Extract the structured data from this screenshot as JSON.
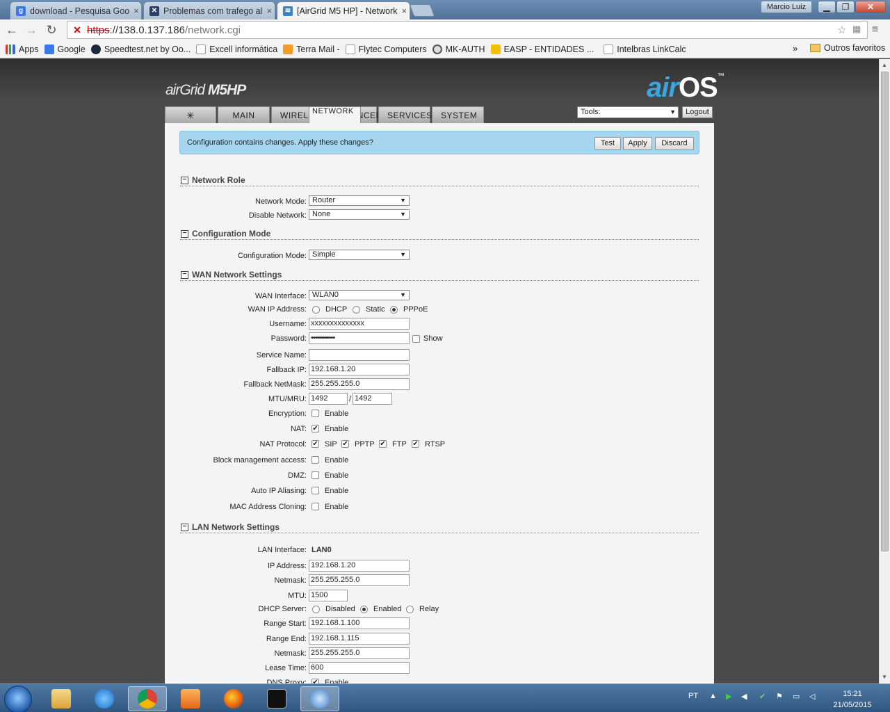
{
  "window": {
    "user": "Marcio Luiz",
    "tabs": [
      {
        "title": "download - Pesquisa Goo",
        "icon": "google-icon"
      },
      {
        "title": "Problemas com trafego al",
        "icon": "mikrotik-icon"
      },
      {
        "title": "[AirGrid M5 HP] - Network",
        "icon": "airos-icon"
      }
    ]
  },
  "address": {
    "proto": "https",
    "host": "://138.0.137.186",
    "path": "/network.cgi"
  },
  "bookmarks": {
    "items": [
      "Apps",
      "Google",
      "Speedtest.net by Oo...",
      "Excell informática",
      "Terra Mail -",
      "Flytec Computers",
      "MK-AUTH",
      "EASP - ENTIDADES ...",
      "Intelbras LinkCalc"
    ],
    "more": "»",
    "other": "Outros favoritos"
  },
  "header": {
    "product_air": "air",
    "product_grid": "Grid",
    "product_model": "M5HP",
    "brand_air": "air",
    "brand_os": "OS",
    "tm": "™",
    "tabs": [
      "MAIN",
      "WIRELESS",
      "NETWORK",
      "ADVANCED",
      "SERVICES",
      "SYSTEM"
    ],
    "tools": "Tools:",
    "logout": "Logout"
  },
  "notice": {
    "message": "Configuration contains changes. Apply these changes?",
    "test": "Test",
    "apply": "Apply",
    "discard": "Discard"
  },
  "network_role": {
    "title": "Network Role",
    "mode_label": "Network Mode:",
    "mode_value": "Router",
    "disable_label": "Disable Network:",
    "disable_value": "None"
  },
  "config_mode": {
    "title": "Configuration Mode",
    "label": "Configuration Mode:",
    "value": "Simple"
  },
  "wan": {
    "title": "WAN Network Settings",
    "interface_label": "WAN Interface:",
    "interface_value": "WLAN0",
    "ip_label": "WAN IP Address:",
    "ip_options": [
      "DHCP",
      "Static",
      "PPPoE"
    ],
    "username_label": "Username:",
    "username_value": "xxxxxxxxxxxxxx",
    "password_label": "Password:",
    "password_value": "••••••••••••",
    "show_label": "Show",
    "service_label": "Service Name:",
    "service_value": "",
    "fallback_ip_label": "Fallback IP:",
    "fallback_ip_value": "192.168.1.20",
    "fallback_mask_label": "Fallback NetMask:",
    "fallback_mask_value": "255.255.255.0",
    "mtu_label": "MTU/MRU:",
    "mtu_value": "1492",
    "mru_sep": "/",
    "mru_value": "1492",
    "encryption_label": "Encryption:",
    "nat_label": "NAT:",
    "nat_protocol_label": "NAT Protocol:",
    "nat_protocols": [
      "SIP",
      "PPTP",
      "FTP",
      "RTSP"
    ],
    "block_label": "Block management access:",
    "dmz_label": "DMZ:",
    "alias_label": "Auto IP Aliasing:",
    "mac_label": "MAC Address Cloning:",
    "enable": "Enable"
  },
  "lan": {
    "title": "LAN Network Settings",
    "interface_label": "LAN Interface:",
    "interface_value": "LAN0",
    "ip_label": "IP Address:",
    "ip_value": "192.168.1.20",
    "mask_label": "Netmask:",
    "mask_value": "255.255.255.0",
    "mtu_label": "MTU:",
    "mtu_value": "1500",
    "dhcp_label": "DHCP Server:",
    "dhcp_options": [
      "Disabled",
      "Enabled",
      "Relay"
    ],
    "start_label": "Range Start:",
    "start_value": "192.168.1.100",
    "end_label": "Range End:",
    "end_value": "192.168.1.115",
    "dhcp_mask_label": "Netmask:",
    "dhcp_mask_value": "255.255.255.0",
    "lease_label": "Lease Time:",
    "lease_value": "600",
    "dns_label": "DNS Proxy:",
    "enable": "Enable"
  },
  "taskbar": {
    "lang": "PT",
    "time": "15:21",
    "date": "21/05/2015"
  }
}
